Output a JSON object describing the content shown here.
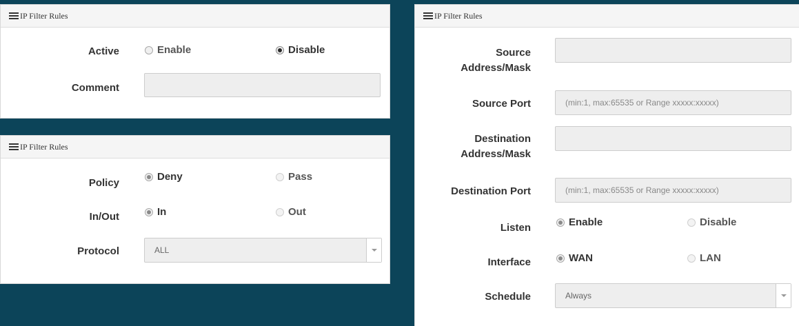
{
  "panel_title": "IP Filter Rules",
  "panel1": {
    "active": {
      "label": "Active",
      "options": [
        "Enable",
        "Disable"
      ],
      "selected": "Disable"
    },
    "comment": {
      "label": "Comment",
      "value": ""
    }
  },
  "panel2": {
    "policy": {
      "label": "Policy",
      "options": [
        "Deny",
        "Pass"
      ],
      "selected": "Deny"
    },
    "inout": {
      "label": "In/Out",
      "options": [
        "In",
        "Out"
      ],
      "selected": "In"
    },
    "protocol": {
      "label": "Protocol",
      "value": "ALL"
    }
  },
  "panel3": {
    "src_addr": {
      "label_line1": "Source",
      "label_line2": "Address/Mask",
      "value": ""
    },
    "src_port": {
      "label": "Source Port",
      "placeholder": "(min:1, max:65535 or Range xxxxx:xxxxx)"
    },
    "dst_addr": {
      "label_line1": "Destination",
      "label_line2": "Address/Mask",
      "value": ""
    },
    "dst_port": {
      "label": "Destination Port",
      "placeholder": "(min:1, max:65535 or Range xxxxx:xxxxx)"
    },
    "listen": {
      "label": "Listen",
      "options": [
        "Enable",
        "Disable"
      ],
      "selected": "Enable"
    },
    "interface": {
      "label": "Interface",
      "options": [
        "WAN",
        "LAN"
      ],
      "selected": "WAN"
    },
    "schedule": {
      "label": "Schedule",
      "value": "Always"
    }
  },
  "colors": {
    "background": "#0c4459",
    "panel_header": "#f5f5f5",
    "field": "#eeeeee"
  }
}
